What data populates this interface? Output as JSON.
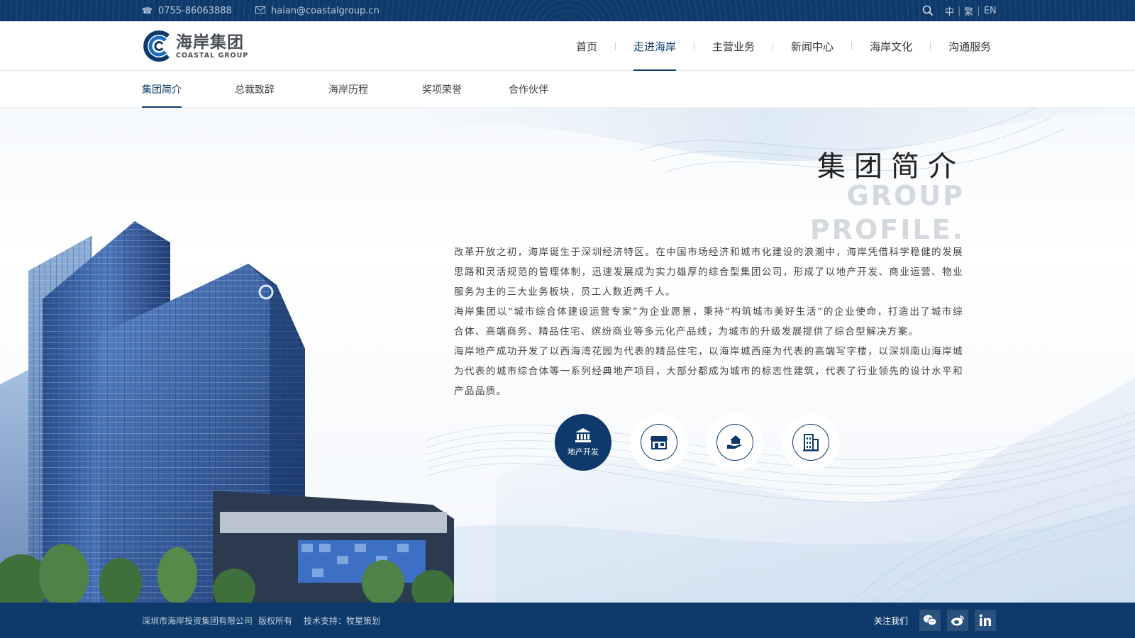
{
  "topbar": {
    "phone": "0755-86063888",
    "email": "haian@coastalgroup.cn",
    "languages": [
      "中",
      "繁",
      "EN"
    ]
  },
  "logo": {
    "cn": "海岸集团",
    "en": "COASTAL GROUP"
  },
  "nav": {
    "items": [
      "首页",
      "走进海岸",
      "主营业务",
      "新闻中心",
      "海岸文化",
      "沟通服务"
    ],
    "active": "走进海岸"
  },
  "subnav": {
    "items": [
      "集团简介",
      "总裁致辞",
      "海岸历程",
      "奖项荣誉",
      "合作伙伴"
    ],
    "active": "集团简介"
  },
  "section": {
    "title_cn": "集团简介",
    "title_en_line1": "GROUP",
    "title_en_line2": "PROFILE.",
    "paragraphs": [
      "改革开放之初，海岸诞生于深圳经济特区。在中国市场经济和城市化建设的浪潮中，海岸凭借科学稳健的发展思路和灵活规范的管理体制，迅速发展成为实力雄厚的综合型集团公司，形成了以地产开发、商业运营、物业服务为主的三大业务板块，员工人数近两千人。",
      "海岸集团以“城市综合体建设运营专家”为企业愿景，秉持“构筑城市美好生活”的企业使命，打造出了城市综合体、高端商务、精品住宅、缤纷商业等多元化产品线，为城市的升级发展提供了综合型解决方案。",
      "海岸地产成功开发了以西海湾花园为代表的精品住宅，以海岸城西座为代表的高端写字楼，以深圳南山海岸城为代表的城市综合体等一系列经典地产项目，大部分都成为城市的标志性建筑，代表了行业领先的设计水平和产品品质。"
    ],
    "business_icons": [
      {
        "icon": "bank-icon",
        "label": "地产开发",
        "active": true
      },
      {
        "icon": "store-icon",
        "label": "",
        "active": false
      },
      {
        "icon": "hand-house-icon",
        "label": "",
        "active": false
      },
      {
        "icon": "office-building-icon",
        "label": "",
        "active": false
      }
    ]
  },
  "footer": {
    "company": "深圳市海岸投资集团有限公司",
    "rights": "版权所有",
    "support": "技术支持：牧星策划",
    "follow": "关注我们"
  },
  "colors": {
    "primary": "#0d3a6a",
    "accent": "#2b6cb0"
  }
}
